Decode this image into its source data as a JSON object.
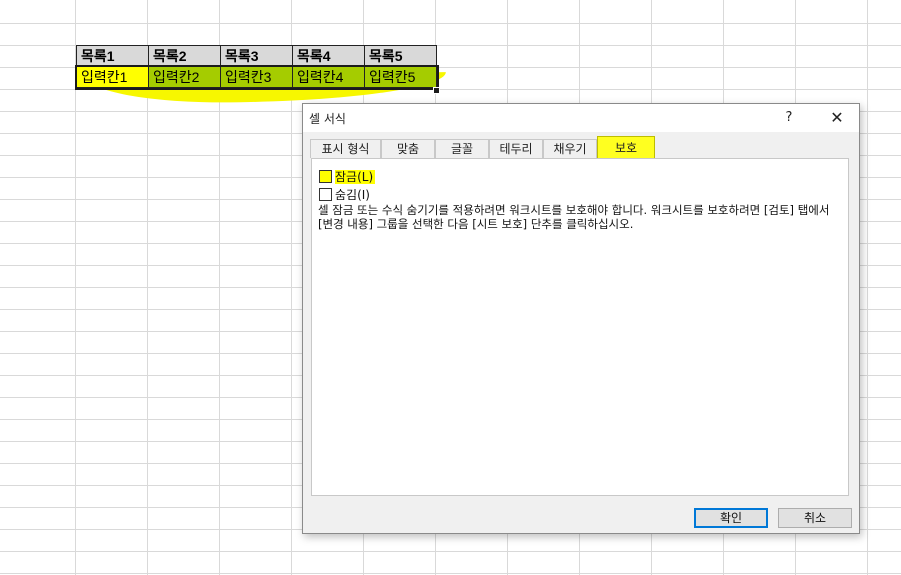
{
  "sheet": {
    "headers": [
      "목록1",
      "목록2",
      "목록3",
      "목록4",
      "목록5"
    ],
    "inputs": [
      "입력칸1",
      "입력칸2",
      "입력칸3",
      "입력칸4",
      "입력칸5"
    ]
  },
  "dialog": {
    "title": "셀 서식",
    "help": "?",
    "close": "✕",
    "tabs": [
      "표시 형식",
      "맞춤",
      "글꼴",
      "테두리",
      "채우기",
      "보호"
    ],
    "active_tab": "보호",
    "lock_label": "잠금(L)",
    "lock_checked": false,
    "hide_label": "숨김(I)",
    "hide_checked": false,
    "description": "셀 잠금 또는 수식 숨기기를 적용하려면 워크시트를 보호해야 합니다. 워크시트를 보호하려면 [검토] 탭에서 [변경 내용] 그룹을 선택한 다음 [시트 보호] 단추를 클릭하십시오.",
    "ok_label": "확인",
    "cancel_label": "취소"
  },
  "colors": {
    "highlight": "#ffff00",
    "input_fill": "#a5cc00",
    "header_fill": "#d9d9d9",
    "focus_border": "#0078d7"
  }
}
